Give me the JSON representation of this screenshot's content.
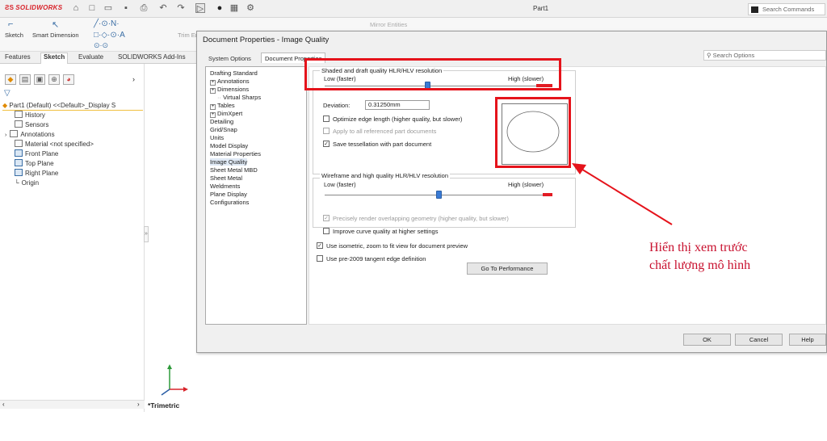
{
  "app": {
    "brand": "SOLIDWORKS",
    "document_title": "Part1",
    "search_commands_placeholder": "Search Commands"
  },
  "command_manager": {
    "sketch_label": "Sketch",
    "smart_dimension_label": "Smart Dimension",
    "trim_label": "Trim En",
    "mirror_label": "Mirror Entities"
  },
  "feature_tabs": [
    "Features",
    "Sketch",
    "Evaluate",
    "SOLIDWORKS Add-Ins"
  ],
  "feature_tree": {
    "root": "Part1 (Default) <<Default>_Display S",
    "items": [
      "History",
      "Sensors",
      "Annotations",
      "Material <not specified>",
      "Front Plane",
      "Top Plane",
      "Right Plane",
      "Origin"
    ]
  },
  "viewport": {
    "view_label": "*Trimetric"
  },
  "dialog": {
    "title": "Document Properties - Image Quality",
    "tabs": [
      "System Options",
      "Document Properties"
    ],
    "search_placeholder": "Search Options",
    "tree": [
      {
        "label": "Drafting Standard",
        "expandable": false,
        "level": 0
      },
      {
        "label": "Annotations",
        "expandable": true,
        "level": 1
      },
      {
        "label": "Dimensions",
        "expandable": true,
        "level": 1
      },
      {
        "label": "Virtual Sharps",
        "expandable": false,
        "level": 2
      },
      {
        "label": "Tables",
        "expandable": true,
        "level": 1
      },
      {
        "label": "DimXpert",
        "expandable": true,
        "level": 1
      },
      {
        "label": "Detailing",
        "expandable": false,
        "level": 0
      },
      {
        "label": "Grid/Snap",
        "expandable": false,
        "level": 0
      },
      {
        "label": "Units",
        "expandable": false,
        "level": 0
      },
      {
        "label": "Model Display",
        "expandable": false,
        "level": 0
      },
      {
        "label": "Material Properties",
        "expandable": false,
        "level": 0
      },
      {
        "label": "Image Quality",
        "expandable": false,
        "level": 0,
        "selected": true
      },
      {
        "label": "Sheet Metal MBD",
        "expandable": false,
        "level": 0
      },
      {
        "label": "Sheet Metal",
        "expandable": false,
        "level": 0
      },
      {
        "label": "Weldments",
        "expandable": false,
        "level": 0
      },
      {
        "label": "Plane Display",
        "expandable": false,
        "level": 0
      },
      {
        "label": "Configurations",
        "expandable": false,
        "level": 0
      }
    ],
    "shaded": {
      "group_title": "Shaded and draft quality HLR/HLV resolution",
      "low_label": "Low (faster)",
      "high_label": "High (slower)",
      "slider_fraction": 0.45,
      "deviation_label": "Deviation:",
      "deviation_value": "0.31250mm",
      "optimize_label": "Optimize edge length (higher quality, but slower)",
      "optimize_checked": false,
      "apply_all_label": "Apply to all referenced part documents",
      "apply_all_checked": false,
      "save_tessellation_label": "Save tessellation with part document",
      "save_tessellation_checked": true
    },
    "wireframe": {
      "group_title": "Wireframe and high quality HLR/HLV resolution",
      "low_label": "Low (faster)",
      "high_label": "High (slower)",
      "slider_fraction": 0.5,
      "precisely_label": "Precisely render overlapping geometry (higher quality, but slower)",
      "precisely_checked": true,
      "improve_label": "Improve curve quality at higher settings",
      "improve_checked": false
    },
    "use_isometric_label": "Use isometric, zoom to fit view for document preview",
    "use_isometric_checked": true,
    "pre2009_label": "Use pre-2009 tangent edge definition",
    "pre2009_checked": false,
    "go_to_performance": "Go To Performance",
    "ok": "OK",
    "cancel": "Cancel",
    "help": "Help"
  },
  "annotation": {
    "line1": "Hiển thị xem trước",
    "line2": "chất lượng mô hình",
    "color": "#e5131b"
  }
}
